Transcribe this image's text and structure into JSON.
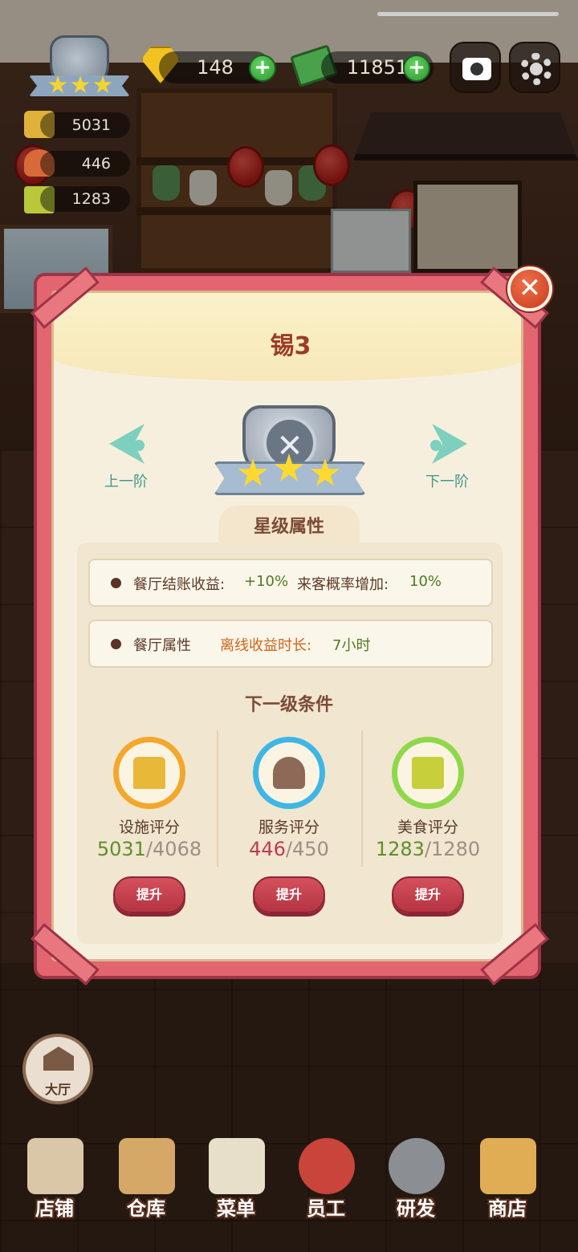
{
  "hud": {
    "gems": "148",
    "cash": "11851",
    "facility_score": "5031",
    "service_score": "446",
    "food_score": "1283"
  },
  "modal": {
    "title": "锡3",
    "prev_label": "上一阶",
    "next_label": "下一阶",
    "star_section_title": "星级属性",
    "attr_row1": {
      "label1": "餐厅结账收益:",
      "value1": "+10%",
      "label2": "来客概率增加:",
      "value2": "10%"
    },
    "attr_row2": {
      "label": "餐厅属性",
      "offline_label": "离线收益时长:",
      "offline_value": "7小时"
    },
    "next_level_title": "下一级条件",
    "conditions": [
      {
        "label": "设施评分",
        "current": "5031",
        "required": "/4068",
        "button": "提升",
        "icon": "stove-icon",
        "ring_color": "#f3a72b"
      },
      {
        "label": "服务评分",
        "current": "446",
        "required": "/450",
        "button": "提升",
        "icon": "cloche-icon",
        "ring_color": "#3eb6e6"
      },
      {
        "label": "美食评分",
        "current": "1283",
        "required": "/1280",
        "button": "提升",
        "icon": "recipe-book-icon",
        "ring_color": "#8fd84a"
      }
    ],
    "stars": 3
  },
  "hall_button": {
    "label": "大厅"
  },
  "bottom_nav": {
    "items": [
      {
        "label": "店铺",
        "icon": "shop-building-icon"
      },
      {
        "label": "仓库",
        "icon": "crates-icon"
      },
      {
        "label": "菜单",
        "icon": "clipboard-icon"
      },
      {
        "label": "员工",
        "icon": "staff-avatar-icon"
      },
      {
        "label": "研发",
        "icon": "wok-icon"
      },
      {
        "label": "商店",
        "icon": "store-icon"
      }
    ]
  },
  "colors": {
    "frame": "#e3656f",
    "panel": "#f7efdd",
    "title": "#9c3b2a",
    "upgrade_button": "#c8414f",
    "accent_teal": "#7dd0bd"
  }
}
